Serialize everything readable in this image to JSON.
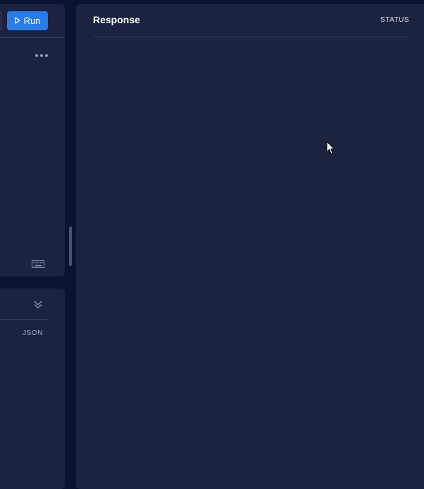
{
  "toolbar": {
    "run_label": "Run"
  },
  "left_top": {
    "more_icon": "more-horizontal-icon",
    "keyboard_icon": "keyboard-icon"
  },
  "left_bottom": {
    "collapse_icon": "chevrons-down-icon",
    "json_label": "JSON"
  },
  "response": {
    "title": "Response",
    "status_label": "STATUS"
  },
  "colors": {
    "background": "#0b1330",
    "panel": "#1b2340",
    "accent": "#2b7be7"
  }
}
